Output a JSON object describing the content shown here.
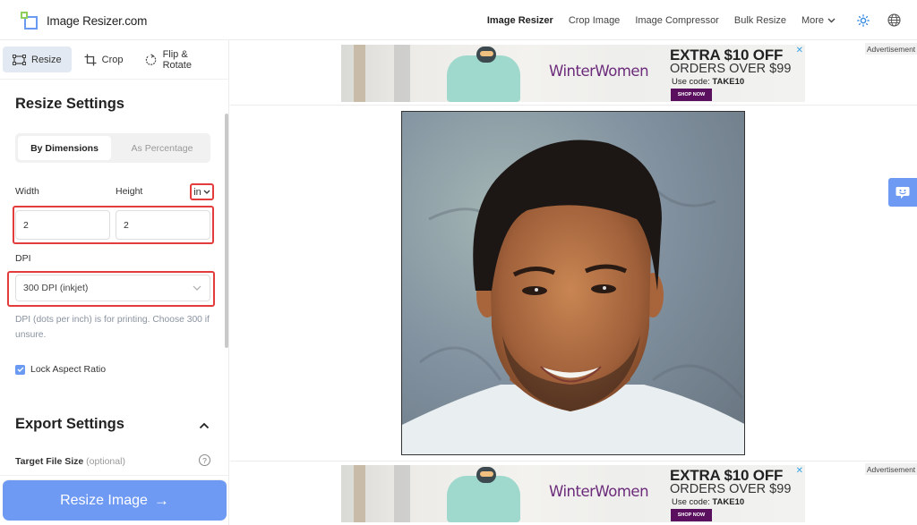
{
  "header": {
    "logo_text": "Image Resizer.com",
    "nav": [
      {
        "label": "Image Resizer",
        "active": true
      },
      {
        "label": "Crop Image",
        "active": false
      },
      {
        "label": "Image Compressor",
        "active": false
      },
      {
        "label": "Bulk Resize",
        "active": false
      },
      {
        "label": "More",
        "active": false
      }
    ],
    "icons": [
      "theme-sun-icon",
      "language-globe-icon"
    ]
  },
  "sidebar": {
    "tabs": [
      {
        "label": "Resize",
        "icon": "resize-icon",
        "active": true
      },
      {
        "label": "Crop",
        "icon": "crop-icon",
        "active": false
      },
      {
        "label": "Flip & Rotate",
        "icon": "rotate-icon",
        "active": false
      }
    ],
    "resize_settings": {
      "title": "Resize Settings",
      "modes": [
        "By Dimensions",
        "As Percentage"
      ],
      "selected_mode": "By Dimensions",
      "width_label": "Width",
      "height_label": "Height",
      "unit": "in",
      "width_value": "2",
      "height_value": "2",
      "dpi_label": "DPI",
      "dpi_value": "300 DPI (inkjet)",
      "dpi_help": "DPI (dots per inch) is for printing. Choose 300 if unsure.",
      "lock_aspect_label": "Lock Aspect Ratio",
      "lock_aspect_checked": true
    },
    "export_settings": {
      "title": "Export Settings",
      "target_file_size_label": "Target File Size",
      "target_file_size_hint": "(optional)"
    },
    "resize_button": "Resize Image",
    "resize_button_arrow": "→"
  },
  "main": {
    "ad_label": "Advertisement",
    "ad": {
      "brand": "WinterWomen",
      "headline": "EXTRA $10 OFF",
      "subheadline": "ORDERS OVER $99",
      "code_prefix": "Use code:",
      "code": "TAKE10",
      "cta": "SHOP NOW",
      "close": "✕"
    },
    "preview_alt": "Portrait photo of smiling man with dark hair and beard"
  },
  "colors": {
    "accent": "#6e9af4",
    "highlight": "#e23c3c",
    "ad_brand": "#6b2a7a",
    "ad_cta": "#5a0f5f"
  }
}
